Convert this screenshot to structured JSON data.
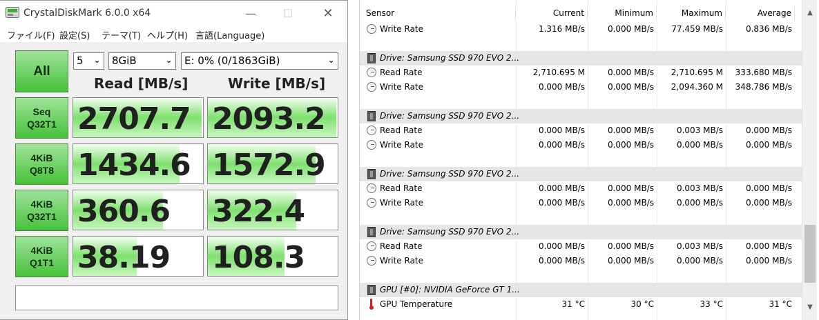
{
  "cdm": {
    "title": "CrystalDiskMark 6.0.0 x64",
    "window_buttons": {
      "minimize": "—",
      "maximize": "☐",
      "close": "✕"
    },
    "menu": [
      "ファイル(F)",
      "設定(S)",
      "テーマ(T)",
      "ヘルプ(H)",
      "言語(Language)"
    ],
    "all_button": "All",
    "count_select": "5",
    "size_select": "8GiB",
    "drive_select": "E: 0% (0/1863GiB)",
    "read_header": "Read [MB/s]",
    "write_header": "Write [MB/s]",
    "rows": [
      {
        "label_1": "Seq",
        "label_2": "Q32T1",
        "read": "2707.7",
        "write": "2093.2",
        "read_fill": 0.99,
        "write_fill": 0.99
      },
      {
        "label_1": "4KiB",
        "label_2": "Q8T8",
        "read": "1434.6",
        "write": "1572.9",
        "read_fill": 0.82,
        "write_fill": 0.83
      },
      {
        "label_1": "4KiB",
        "label_2": "Q32T1",
        "read": "360.6",
        "write": "322.4",
        "read_fill": 0.69,
        "write_fill": 0.68
      },
      {
        "label_1": "4KiB",
        "label_2": "Q1T1",
        "read": "38.19",
        "write": "108.3",
        "read_fill": 0.49,
        "write_fill": 0.59
      }
    ],
    "comment": ""
  },
  "hwinfo": {
    "columns": {
      "sensor": "Sensor",
      "current": "Current",
      "minimum": "Minimum",
      "maximum": "Maximum",
      "average": "Average"
    },
    "rows": [
      {
        "type": "sensor",
        "icon": "clock-icon",
        "name": "Write Rate",
        "current": "1.316 MB/s",
        "minimum": "0.000 MB/s",
        "maximum": "77.459 MB/s",
        "average": "0.836 MB/s"
      },
      {
        "type": "blank"
      },
      {
        "type": "group",
        "icon": "drive-icon",
        "name": "Drive: Samsung SSD 970 EVO 2..."
      },
      {
        "type": "sensor",
        "icon": "clock-icon",
        "name": "Read Rate",
        "current": "2,710.695 M",
        "minimum": "0.000 MB/s",
        "maximum": "2,710.695 M",
        "average": "333.680 MB/s"
      },
      {
        "type": "sensor",
        "icon": "clock-icon",
        "name": "Write Rate",
        "current": "0.000 MB/s",
        "minimum": "0.000 MB/s",
        "maximum": "2,094.360 M",
        "average": "348.786 MB/s"
      },
      {
        "type": "blank"
      },
      {
        "type": "group",
        "icon": "drive-icon",
        "name": "Drive: Samsung SSD 970 EVO 2..."
      },
      {
        "type": "sensor",
        "icon": "clock-icon",
        "name": "Read Rate",
        "current": "0.000 MB/s",
        "minimum": "0.000 MB/s",
        "maximum": "0.003 MB/s",
        "average": "0.000 MB/s"
      },
      {
        "type": "sensor",
        "icon": "clock-icon",
        "name": "Write Rate",
        "current": "0.000 MB/s",
        "minimum": "0.000 MB/s",
        "maximum": "0.000 MB/s",
        "average": "0.000 MB/s"
      },
      {
        "type": "blank"
      },
      {
        "type": "group",
        "icon": "drive-icon",
        "name": "Drive: Samsung SSD 970 EVO 2..."
      },
      {
        "type": "sensor",
        "icon": "clock-icon",
        "name": "Read Rate",
        "current": "0.000 MB/s",
        "minimum": "0.000 MB/s",
        "maximum": "0.003 MB/s",
        "average": "0.000 MB/s"
      },
      {
        "type": "sensor",
        "icon": "clock-icon",
        "name": "Write Rate",
        "current": "0.000 MB/s",
        "minimum": "0.000 MB/s",
        "maximum": "0.000 MB/s",
        "average": "0.000 MB/s"
      },
      {
        "type": "blank"
      },
      {
        "type": "group",
        "icon": "drive-icon",
        "name": "Drive: Samsung SSD 970 EVO 2..."
      },
      {
        "type": "sensor",
        "icon": "clock-icon",
        "name": "Read Rate",
        "current": "0.000 MB/s",
        "minimum": "0.000 MB/s",
        "maximum": "0.003 MB/s",
        "average": "0.000 MB/s"
      },
      {
        "type": "sensor",
        "icon": "clock-icon",
        "name": "Write Rate",
        "current": "0.000 MB/s",
        "minimum": "0.000 MB/s",
        "maximum": "0.000 MB/s",
        "average": "0.000 MB/s"
      },
      {
        "type": "blank"
      },
      {
        "type": "group",
        "icon": "gpu-icon",
        "name": "GPU [#0]: NVIDIA GeForce GT 1..."
      },
      {
        "type": "sensor",
        "icon": "thermometer-icon",
        "name": "GPU Temperature",
        "current": "31 °C",
        "minimum": "30 °C",
        "maximum": "33 °C",
        "average": "31 °C"
      }
    ],
    "scroll": {
      "up": "▲",
      "down": "▼"
    }
  }
}
